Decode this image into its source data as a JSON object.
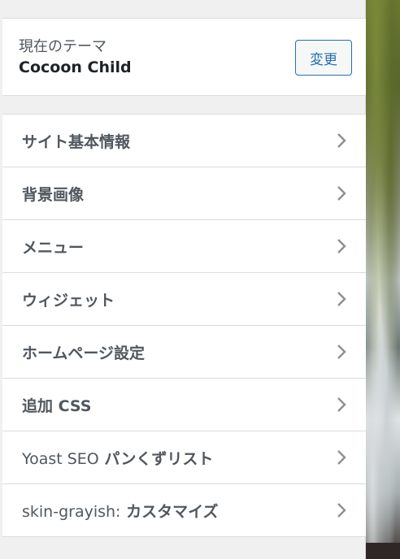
{
  "theme": {
    "caption": "現在のテーマ",
    "name": "Cocoon Child",
    "change_label": "変更"
  },
  "menu": {
    "items": [
      {
        "label": "サイト基本情報",
        "icon": "chevron-right-icon"
      },
      {
        "label": "背景画像",
        "icon": "chevron-right-icon"
      },
      {
        "label": "メニュー",
        "icon": "chevron-right-icon"
      },
      {
        "label": "ウィジェット",
        "icon": "chevron-right-icon"
      },
      {
        "label": "ホームページ設定",
        "icon": "chevron-right-icon"
      },
      {
        "label": "追加 CSS",
        "icon": "chevron-right-icon"
      },
      {
        "label_prefix": "Yoast SEO",
        "label_suffix": " パンくずリスト",
        "icon": "chevron-right-icon"
      },
      {
        "label_prefix": "skin-grayish:",
        "label_suffix": " カスタマイズ",
        "icon": "chevron-right-icon"
      }
    ]
  },
  "colors": {
    "accent": "#2271b1",
    "text": "#50575e",
    "background": "#f0f0f1"
  }
}
